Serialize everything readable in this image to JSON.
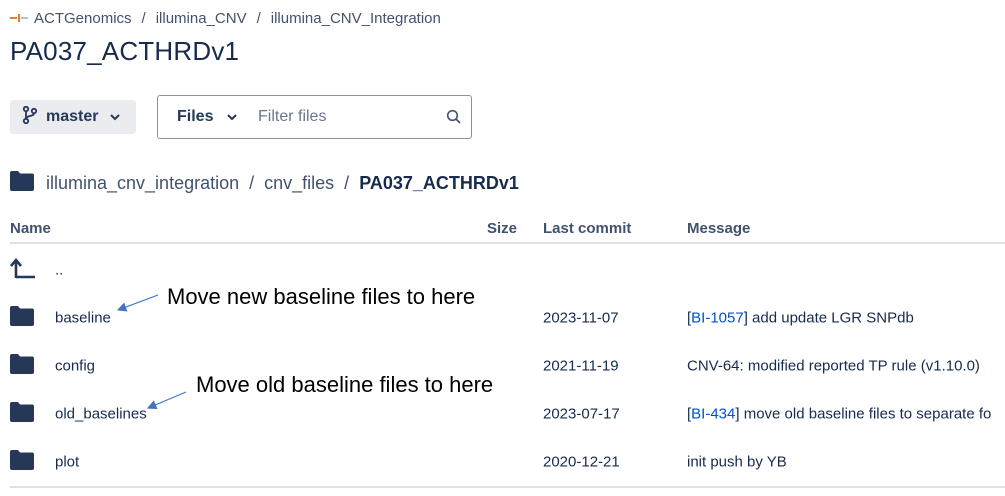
{
  "breadcrumb": {
    "items": [
      "ACTGenomics",
      "illumina_CNV",
      "illumina_CNV_Integration"
    ],
    "separator": "/"
  },
  "page_title": "PA037_ACTHRDv1",
  "toolbar": {
    "branch_label": "master",
    "files_label": "Files",
    "filter_placeholder": "Filter files",
    "filter_value": ""
  },
  "path": {
    "items": [
      "illumina_cnv_integration",
      "cnv_files"
    ],
    "current": "PA037_ACTHRDv1",
    "separator": "/"
  },
  "table": {
    "headers": {
      "name": "Name",
      "size": "Size",
      "last_commit": "Last commit",
      "message": "Message"
    },
    "parent_label": "..",
    "rows": [
      {
        "name": "baseline",
        "date": "2023-11-07",
        "msg_prefix": "[",
        "issue": "BI-1057",
        "msg_suffix": "] add update LGR SNPdb"
      },
      {
        "name": "config",
        "date": "2021-11-19",
        "msg_prefix": "",
        "issue": "",
        "msg_suffix": "CNV-64: modified reported TP rule (v1.10.0)"
      },
      {
        "name": "old_baselines",
        "date": "2023-07-17",
        "msg_prefix": "[",
        "issue": "BI-434",
        "msg_suffix": "] move old baseline files to separate fo"
      },
      {
        "name": "plot",
        "date": "2020-12-21",
        "msg_prefix": "",
        "issue": "",
        "msg_suffix": "init push by YB"
      }
    ]
  },
  "annotations": {
    "new_baseline": "Move new baseline files to here",
    "old_baseline": "Move old baseline files to here"
  },
  "colors": {
    "folder": "#253858",
    "link": "#0052cc",
    "branch_bg": "#ebecf0",
    "text": "#172b4d",
    "muted": "#42526e"
  },
  "icons": {
    "branch": "git-branch-icon",
    "folder": "folder-icon",
    "search": "search-icon",
    "parent": "parent-directory-icon",
    "chevron": "chevron-down-icon",
    "logo": "bitbucket-logo-icon"
  }
}
